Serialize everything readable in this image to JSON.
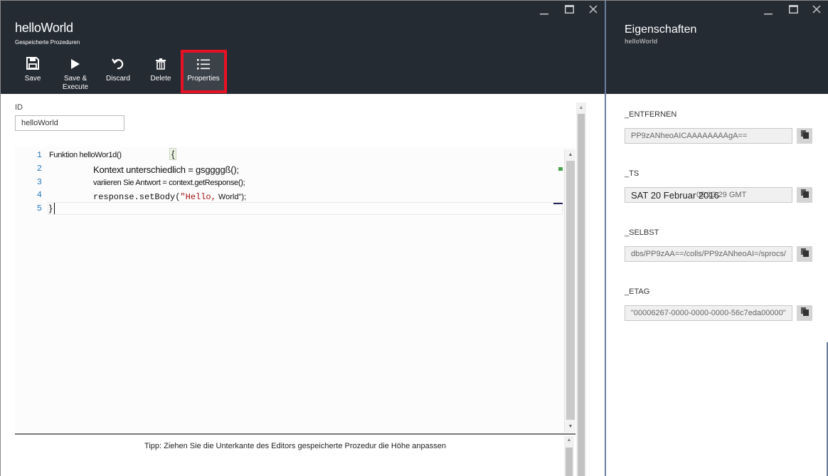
{
  "left_blade": {
    "title": "helloWorld",
    "subtitle": "Gespeicherte Prozeduren",
    "toolbar": {
      "save": "Save",
      "save_execute_line1": "Save &",
      "save_execute_line2": "Execute",
      "discard": "Discard",
      "delete": "Delete",
      "properties": "Properties"
    },
    "id_label": "ID",
    "id_value": "helloWorld",
    "editor": {
      "line_numbers": [
        "1",
        "2",
        "3",
        "4",
        "5"
      ],
      "line1": "Funktion helloWor1d()",
      "line1_brace": "{",
      "line2": "Kontext unterschiedlich = gsggggß();",
      "line3": "variieren Sie Antwort = context.getResponse();",
      "line4_code": "response.setBody(",
      "line4_str": "\"Hello,",
      "line4_rest": "World\");",
      "line5": "}"
    },
    "tip": "Tipp: Ziehen Sie die Unterkante des Editors gespeicherte Prozedur die Höhe anpassen"
  },
  "right_blade": {
    "title": "Eigenschaften",
    "subtitle": "helloWorld",
    "properties": [
      {
        "label": "_ENTFERNEN",
        "value": "PP9zANheoAICAAAAAAAAgA=="
      },
      {
        "label": "_TS",
        "value": "SAT 20 Februar 2016",
        "extra": "09:13:29 GMT"
      },
      {
        "label": "_SELBST",
        "value": "dbs/PP9zAA==/colls/PP9zANheoAI=/sprocs/"
      },
      {
        "label": "_ETAG",
        "value": "\"00006267-0000-0000-0000-56c7eda00000\""
      }
    ]
  },
  "colors": {
    "header_bg": "#252b33",
    "highlight_border": "#e81123",
    "line_number": "#2a7ab9",
    "string": "#a31515"
  }
}
